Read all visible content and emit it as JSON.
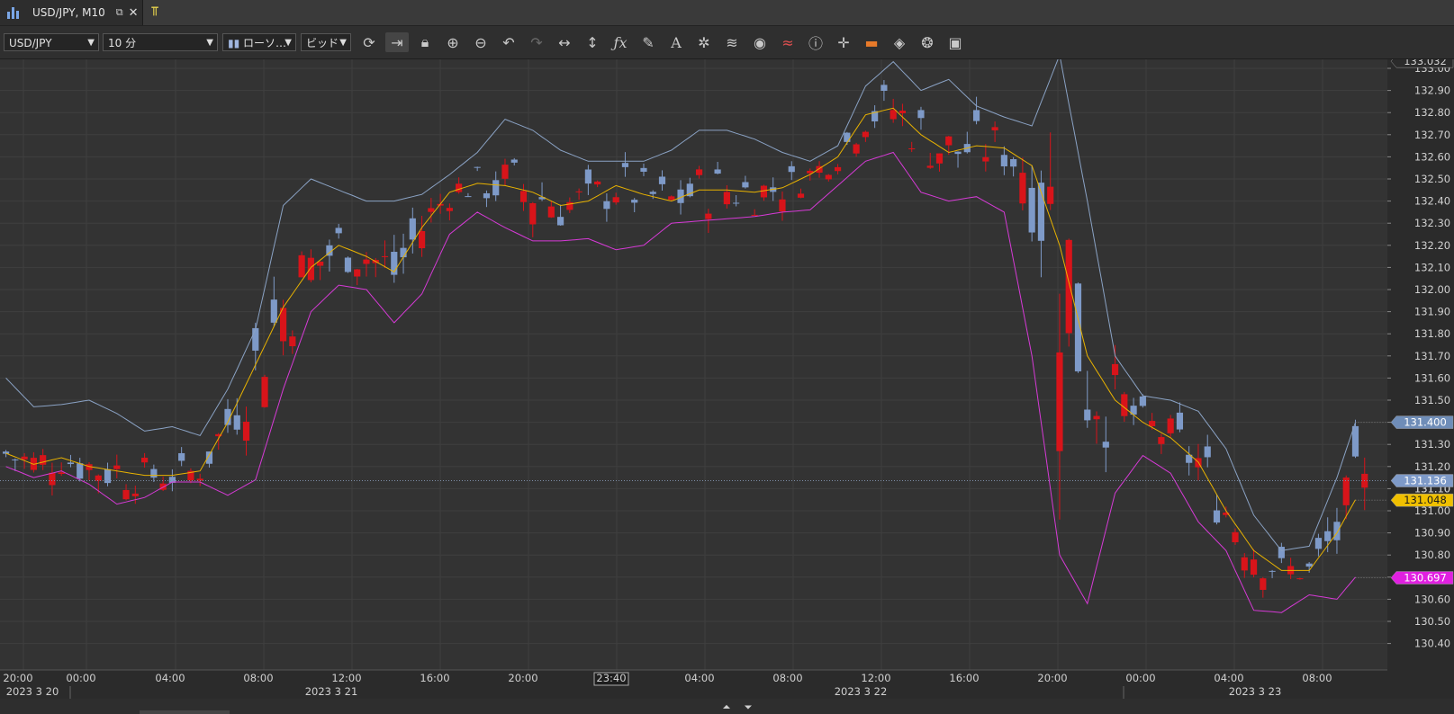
{
  "tab": {
    "title": "USD/JPY, M10",
    "icon": "candlestick-chart-icon",
    "popout_icon": "popout-icon",
    "close_icon": "close-icon",
    "add_icon": "add-chart-icon"
  },
  "toolbar": {
    "symbol": "USD/JPY",
    "timeframe": "10 分",
    "chart_style": "ローソ…",
    "price_side": "ビッド",
    "icons": [
      "refresh-icon",
      "autoscroll-icon",
      "lock-icon",
      "zoom-in-icon",
      "zoom-out-icon",
      "undo-icon",
      "redo-icon",
      "horizontal-scale-icon",
      "vertical-scale-icon",
      "indicator-fx-icon",
      "draw-pencil-icon",
      "text-tool-icon",
      "objects-icon",
      "layers-icon",
      "eye-icon",
      "chart-shift-icon",
      "info-icon",
      "crosshair-icon",
      "color-scheme-icon",
      "paint-bucket-icon",
      "cycle-icon",
      "save-icon"
    ]
  },
  "colors": {
    "background": "#333333",
    "grid": "#3f3f3f",
    "bull": "#d8141a",
    "bear": "#7e9ac8",
    "upper_band": "#8aa2c4",
    "mid_band": "#e8b200",
    "lower_band": "#d63ad6",
    "axis_bg": "#2b2b2b"
  },
  "chart_data": {
    "type": "candlestick",
    "symbol": "USD/JPY",
    "timeframe": "M10",
    "y_ticks": [
      133.0,
      132.9,
      132.8,
      132.7,
      132.6,
      132.5,
      132.4,
      132.3,
      132.2,
      132.1,
      132.0,
      131.9,
      131.8,
      131.7,
      131.6,
      131.5,
      131.4,
      131.3,
      131.2,
      131.1,
      131.0,
      130.9,
      130.8,
      130.7,
      130.6,
      130.5,
      130.4
    ],
    "x_ticks": [
      "20:00",
      "00:00",
      "04:00",
      "08:00",
      "12:00",
      "16:00",
      "20:00",
      "23:40",
      "04:00",
      "08:00",
      "12:00",
      "16:00",
      "20:00",
      "00:00",
      "04:00",
      "08:00"
    ],
    "date_labels": [
      "2023 3 20",
      "2023 3 21",
      "2023 3 22",
      "2023 3 23"
    ],
    "crosshair_time": "23:40",
    "price_badges": {
      "top": "133.032",
      "upper_band": "131.400",
      "current": "131.136",
      "mid_band": "131.048",
      "lower_band": "130.697"
    },
    "overlapped_tick": "131.10",
    "bollinger_upper": [
      [
        0,
        131.6
      ],
      [
        3,
        131.47
      ],
      [
        6,
        131.48
      ],
      [
        9,
        131.5
      ],
      [
        12,
        131.44
      ],
      [
        15,
        131.36
      ],
      [
        18,
        131.38
      ],
      [
        21,
        131.34
      ],
      [
        24,
        131.55
      ],
      [
        27,
        131.82
      ],
      [
        30,
        132.38
      ],
      [
        33,
        132.5
      ],
      [
        36,
        132.45
      ],
      [
        39,
        132.4
      ],
      [
        42,
        132.4
      ],
      [
        45,
        132.43
      ],
      [
        48,
        132.52
      ],
      [
        51,
        132.62
      ],
      [
        54,
        132.77
      ],
      [
        57,
        132.72
      ],
      [
        60,
        132.63
      ],
      [
        63,
        132.58
      ],
      [
        66,
        132.58
      ],
      [
        69,
        132.58
      ],
      [
        72,
        132.63
      ],
      [
        75,
        132.72
      ],
      [
        78,
        132.72
      ],
      [
        81,
        132.68
      ],
      [
        84,
        132.62
      ],
      [
        87,
        132.58
      ],
      [
        90,
        132.65
      ],
      [
        93,
        132.92
      ],
      [
        96,
        133.03
      ],
      [
        99,
        132.9
      ],
      [
        102,
        132.95
      ],
      [
        105,
        132.83
      ],
      [
        108,
        132.78
      ],
      [
        111,
        132.74
      ],
      [
        114,
        133.06
      ],
      [
        117,
        132.4
      ],
      [
        120,
        131.7
      ],
      [
        123,
        131.52
      ],
      [
        126,
        131.5
      ],
      [
        129,
        131.45
      ],
      [
        132,
        131.28
      ],
      [
        135,
        130.98
      ],
      [
        138,
        130.82
      ],
      [
        141,
        130.84
      ],
      [
        144,
        131.15
      ],
      [
        146,
        131.4
      ]
    ],
    "bollinger_mid": [
      [
        0,
        131.26
      ],
      [
        3,
        131.21
      ],
      [
        6,
        131.24
      ],
      [
        9,
        131.2
      ],
      [
        12,
        131.18
      ],
      [
        15,
        131.16
      ],
      [
        18,
        131.16
      ],
      [
        21,
        131.18
      ],
      [
        24,
        131.4
      ],
      [
        27,
        131.66
      ],
      [
        30,
        131.92
      ],
      [
        33,
        132.1
      ],
      [
        36,
        132.2
      ],
      [
        39,
        132.15
      ],
      [
        42,
        132.08
      ],
      [
        45,
        132.28
      ],
      [
        48,
        132.44
      ],
      [
        51,
        132.48
      ],
      [
        54,
        132.47
      ],
      [
        57,
        132.44
      ],
      [
        60,
        132.38
      ],
      [
        63,
        132.4
      ],
      [
        66,
        132.47
      ],
      [
        69,
        132.43
      ],
      [
        72,
        132.4
      ],
      [
        75,
        132.45
      ],
      [
        78,
        132.45
      ],
      [
        81,
        132.44
      ],
      [
        84,
        132.46
      ],
      [
        87,
        132.52
      ],
      [
        90,
        132.6
      ],
      [
        93,
        132.79
      ],
      [
        96,
        132.82
      ],
      [
        99,
        132.7
      ],
      [
        102,
        132.62
      ],
      [
        105,
        132.65
      ],
      [
        108,
        132.64
      ],
      [
        111,
        132.56
      ],
      [
        114,
        132.2
      ],
      [
        117,
        131.7
      ],
      [
        120,
        131.5
      ],
      [
        123,
        131.4
      ],
      [
        126,
        131.33
      ],
      [
        129,
        131.22
      ],
      [
        132,
        131.0
      ],
      [
        135,
        130.82
      ],
      [
        138,
        130.73
      ],
      [
        141,
        130.73
      ],
      [
        144,
        130.9
      ],
      [
        146,
        131.05
      ]
    ],
    "bollinger_lower": [
      [
        0,
        131.2
      ],
      [
        3,
        131.15
      ],
      [
        6,
        131.18
      ],
      [
        9,
        131.12
      ],
      [
        12,
        131.03
      ],
      [
        15,
        131.06
      ],
      [
        18,
        131.13
      ],
      [
        21,
        131.13
      ],
      [
        24,
        131.07
      ],
      [
        27,
        131.14
      ],
      [
        30,
        131.55
      ],
      [
        33,
        131.9
      ],
      [
        36,
        132.02
      ],
      [
        39,
        132.0
      ],
      [
        42,
        131.85
      ],
      [
        45,
        131.98
      ],
      [
        48,
        132.25
      ],
      [
        51,
        132.35
      ],
      [
        54,
        132.28
      ],
      [
        57,
        132.22
      ],
      [
        60,
        132.22
      ],
      [
        63,
        132.23
      ],
      [
        66,
        132.18
      ],
      [
        69,
        132.2
      ],
      [
        72,
        132.3
      ],
      [
        75,
        132.31
      ],
      [
        78,
        132.32
      ],
      [
        81,
        132.33
      ],
      [
        84,
        132.35
      ],
      [
        87,
        132.36
      ],
      [
        90,
        132.47
      ],
      [
        93,
        132.58
      ],
      [
        96,
        132.62
      ],
      [
        99,
        132.44
      ],
      [
        102,
        132.4
      ],
      [
        105,
        132.42
      ],
      [
        108,
        132.35
      ],
      [
        111,
        131.7
      ],
      [
        114,
        130.8
      ],
      [
        117,
        130.58
      ],
      [
        120,
        131.08
      ],
      [
        123,
        131.25
      ],
      [
        126,
        131.17
      ],
      [
        129,
        130.95
      ],
      [
        132,
        130.82
      ],
      [
        135,
        130.55
      ],
      [
        138,
        130.54
      ],
      [
        141,
        130.62
      ],
      [
        144,
        130.6
      ],
      [
        146,
        130.7
      ]
    ]
  }
}
